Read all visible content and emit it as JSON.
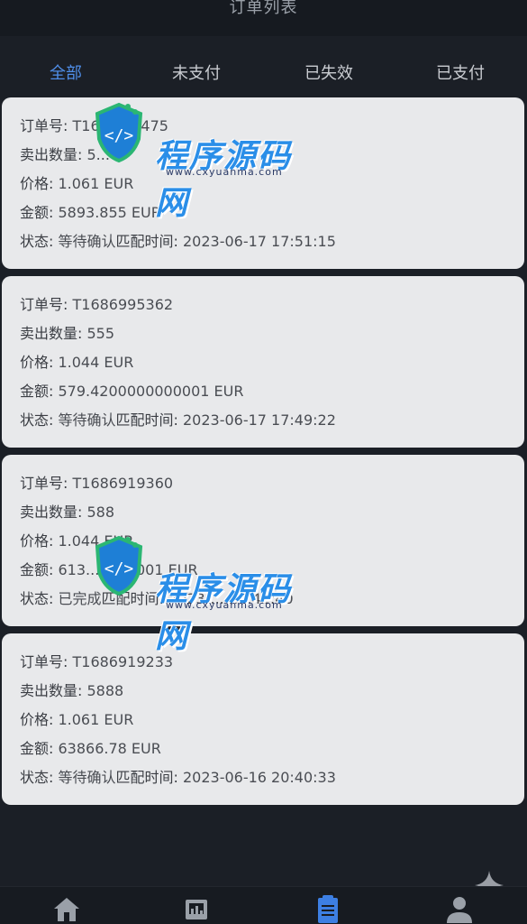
{
  "header": {
    "title": "订单列表"
  },
  "tabs": [
    {
      "label": "全部",
      "active": true
    },
    {
      "label": "未支付",
      "active": false
    },
    {
      "label": "已失效",
      "active": false
    },
    {
      "label": "已支付",
      "active": false
    }
  ],
  "labels": {
    "order_no": "订单号: ",
    "qty": "卖出数量: ",
    "price": "价格: ",
    "amount": "金额: ",
    "status": "状态: ",
    "match_time": "匹配时间: "
  },
  "orders": [
    {
      "order_no": "T1686...5475",
      "qty": "5...",
      "price": "1.061 EUR",
      "amount": "5893.855 EUR",
      "status": "等待确认",
      "match_time": "2023-06-17 17:51:15"
    },
    {
      "order_no": "T1686995362",
      "qty": "555",
      "price": "1.044 EUR",
      "amount": "579.4200000000001 EUR",
      "status": "等待确认",
      "match_time": "2023-06-17 17:49:22"
    },
    {
      "order_no": "T1686919360",
      "qty": "588",
      "price": "1.044 EUR",
      "amount": "613...0000001 EUR",
      "status": "已完成",
      "match_time": "2023-... 20:42:40"
    },
    {
      "order_no": "T1686919233",
      "qty": "5888",
      "price": "1.061 EUR",
      "amount": "63866.78 EUR",
      "status": "等待确认",
      "match_time": "2023-06-16 20:40:33"
    }
  ],
  "watermark": {
    "text": "程序源码网",
    "url": "www.cxyuanma.com"
  },
  "bottom_nav": [
    {
      "icon": "home-icon"
    },
    {
      "icon": "market-icon"
    },
    {
      "icon": "orders-icon",
      "active": true
    },
    {
      "icon": "profile-icon"
    }
  ],
  "colors": {
    "accent": "#4f8ee8",
    "background": "#1b1f26",
    "card": "#e8e9eb"
  }
}
